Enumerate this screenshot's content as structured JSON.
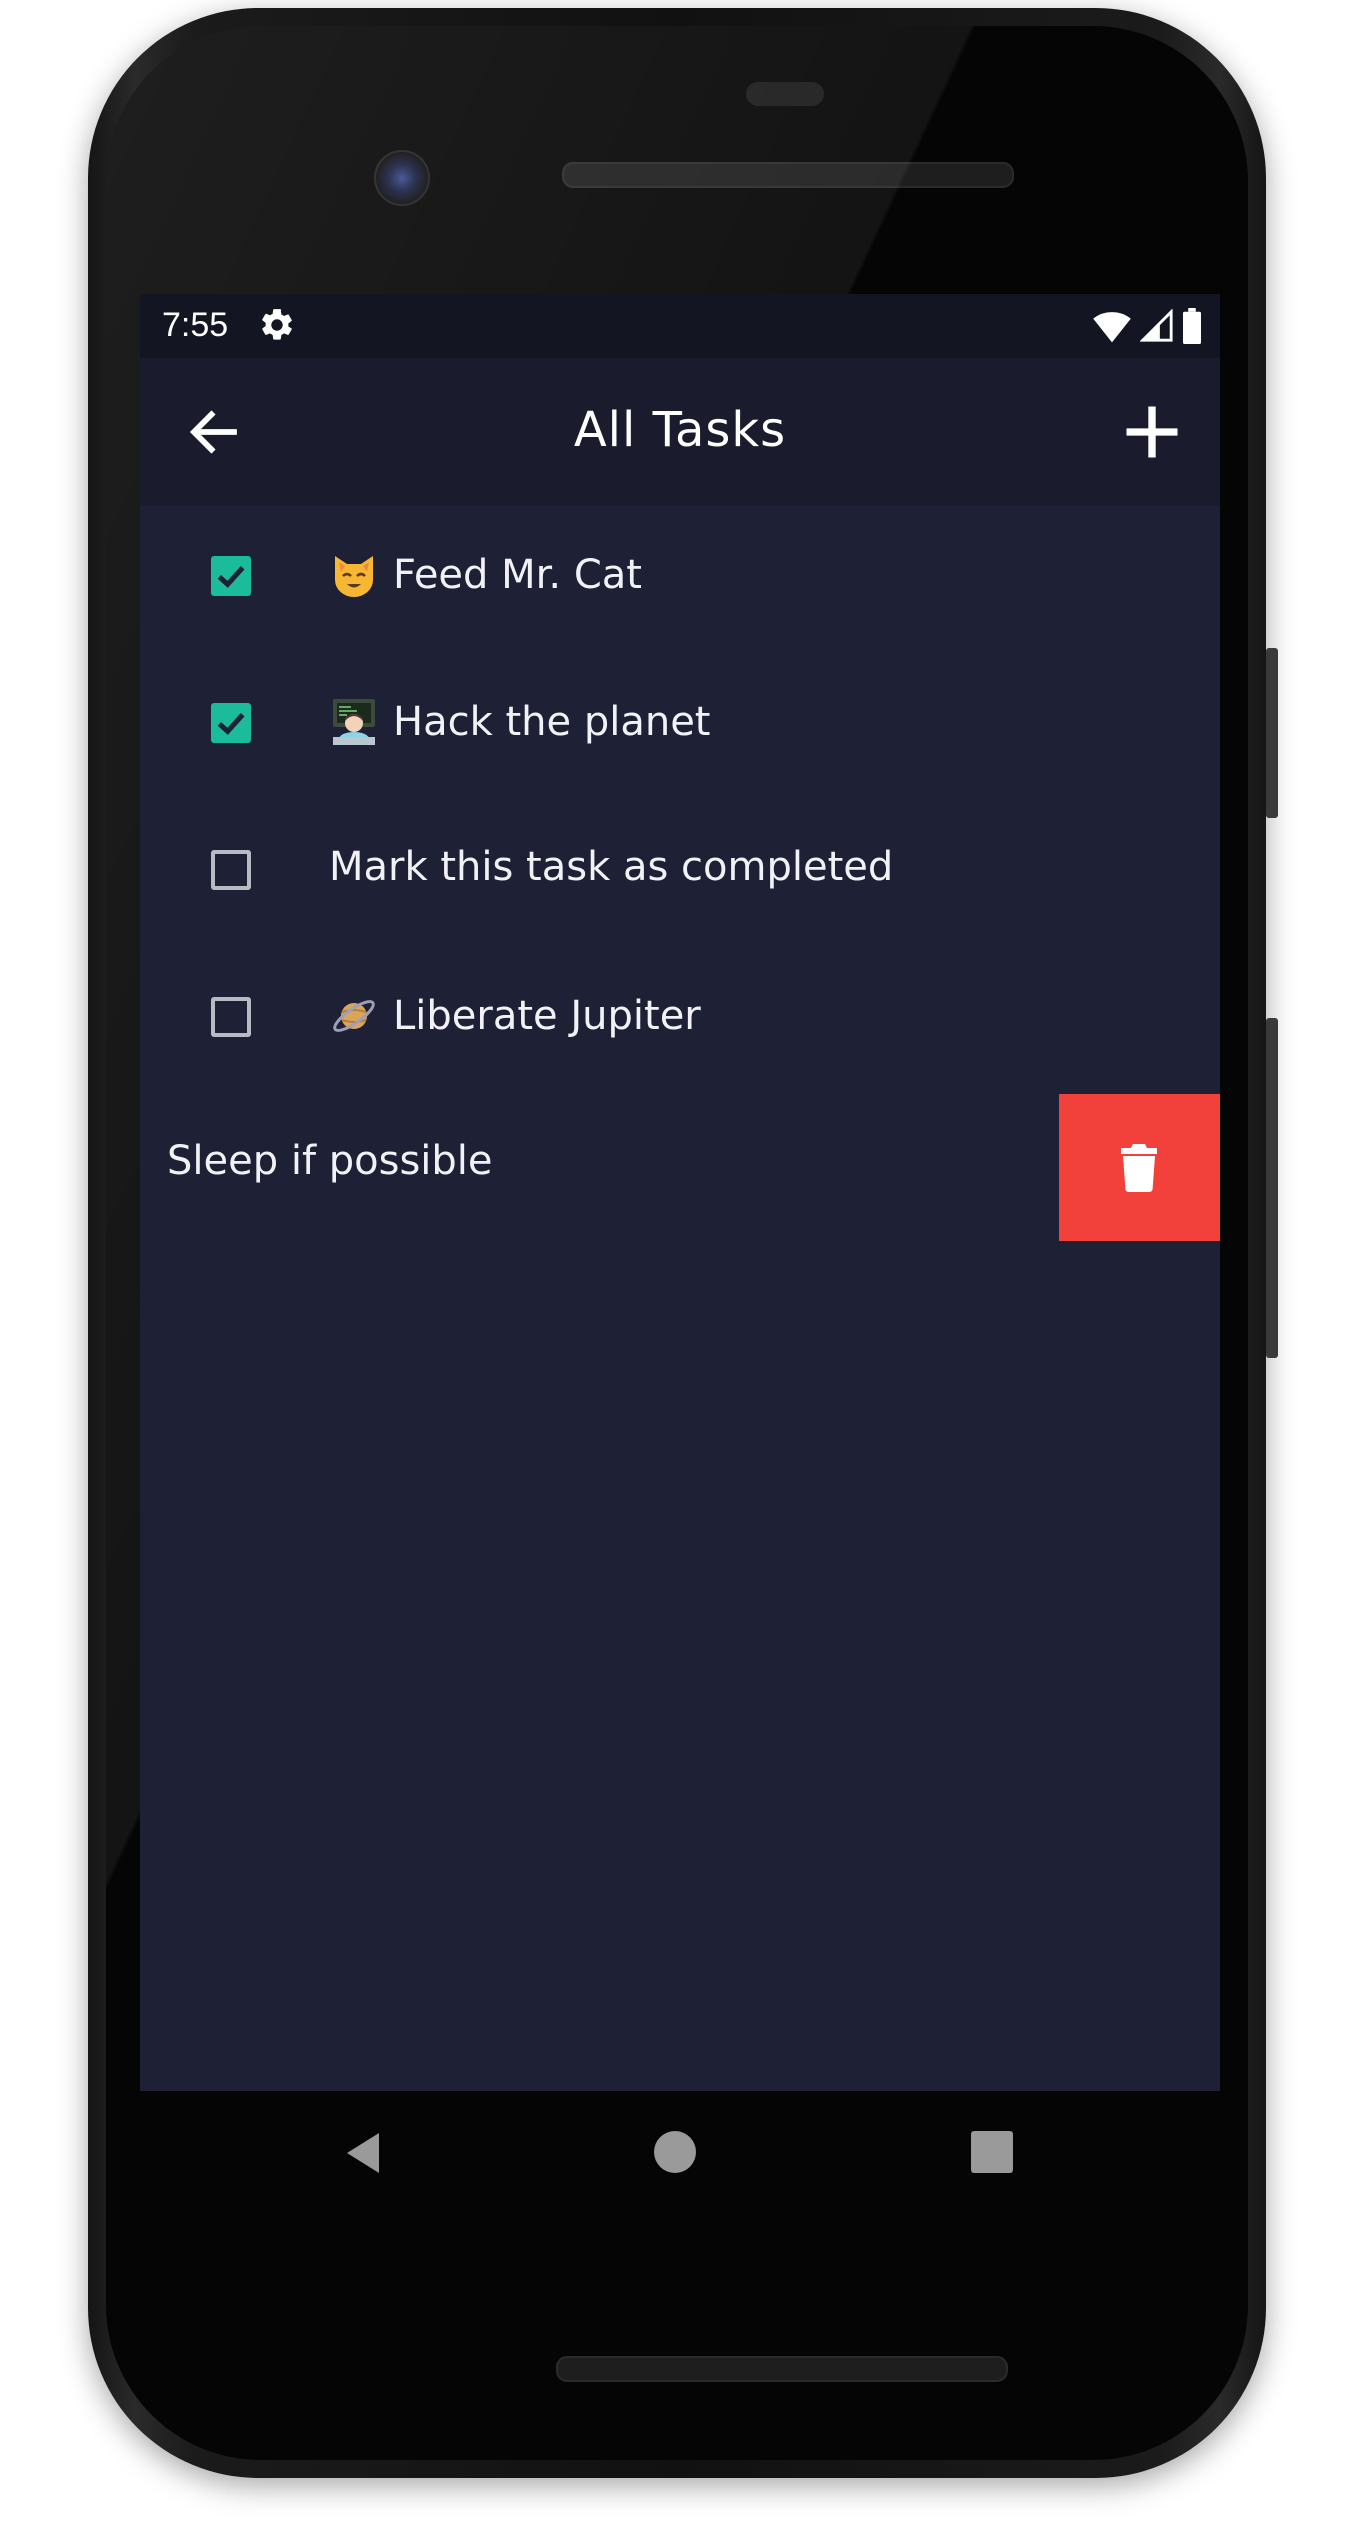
{
  "status_bar": {
    "time": "7:55",
    "icons": [
      "gear-icon",
      "wifi-icon",
      "signal-icon",
      "battery-icon"
    ]
  },
  "app_bar": {
    "title": "All Tasks",
    "back_icon": "arrow-left-icon",
    "add_icon": "plus-icon"
  },
  "tasks": [
    {
      "emoji": "cat-face-emoji",
      "label": "Feed Mr. Cat",
      "completed": true
    },
    {
      "emoji": "technologist-emoji",
      "label": "Hack the planet",
      "completed": true
    },
    {
      "emoji": "",
      "label": "Mark this task as completed",
      "completed": false
    },
    {
      "emoji": "ringed-planet-emoji",
      "label": "Liberate Jupiter",
      "completed": false
    }
  ],
  "swiped_task": {
    "label": "Sleep if possible",
    "action_icon": "trash-icon"
  },
  "nav_bar": {
    "icons": [
      "back-triangle-icon",
      "home-circle-icon",
      "recents-square-icon"
    ]
  },
  "colors": {
    "background": "#1e2035",
    "app_bar": "#1a1c2e",
    "status_bar": "#131522",
    "accent": "#1bbc9b",
    "delete": "#f2413a",
    "text": "#f1f2f6"
  }
}
